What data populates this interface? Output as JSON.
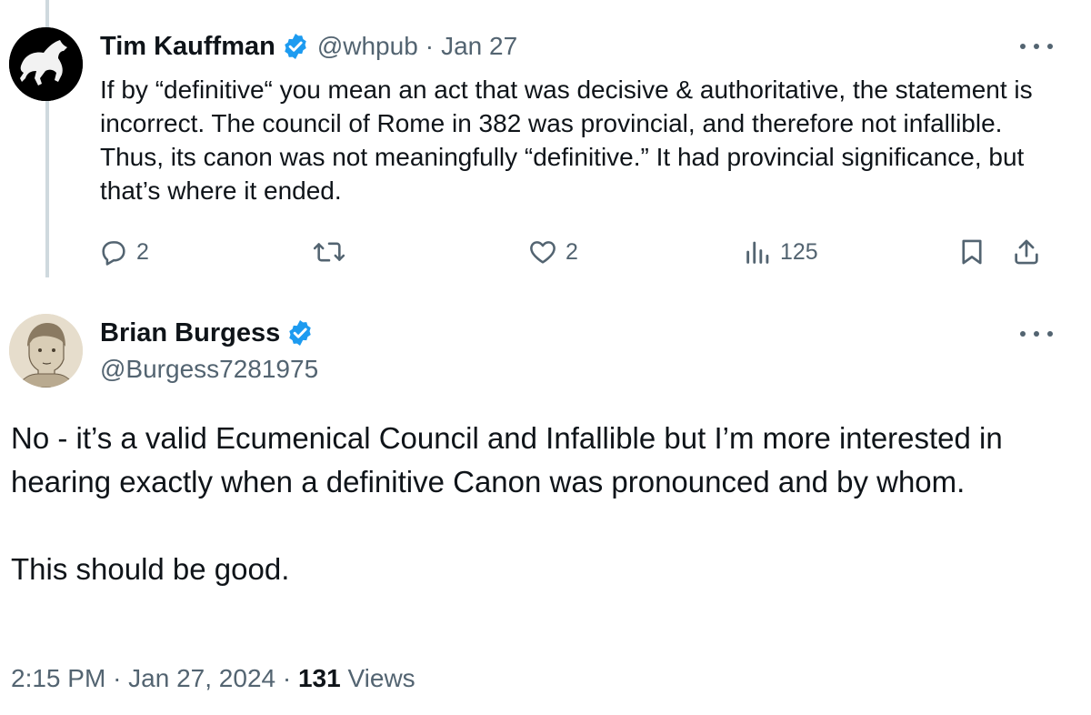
{
  "tweet1": {
    "name": "Tim Kauffman",
    "handle": "@whpub",
    "separator": "·",
    "date": "Jan 27",
    "text": "If by “definitive“ you mean an act that was decisive & authoritative, the statement is incorrect. The council of Rome in 382 was provincial, and therefore not infallible. Thus, its canon was not meaningfully “definitive.” It had provincial significance, but that’s where it ended.",
    "replies": "2",
    "likes": "2",
    "views": "125",
    "icons": [
      "reply-icon",
      "retweet-icon",
      "like-icon",
      "views-icon",
      "bookmark-icon",
      "share-icon",
      "more-icon",
      "verified-badge-icon"
    ]
  },
  "tweet2": {
    "name": "Brian Burgess",
    "handle": "@Burgess7281975",
    "paragraphs": [
      "No - it’s a valid Ecumenical Council and Infallible but I’m more interested in hearing exactly when a definitive Canon was pronounced and by whom.",
      "This should be good."
    ],
    "time": "2:15 PM",
    "sep1": "·",
    "full_date": "Jan 27, 2024",
    "sep2": "·",
    "views_count": "131",
    "views_label": "Views"
  },
  "colors": {
    "text": "#0f1419",
    "secondary": "#536471",
    "verified": "#1d9bf0",
    "thread_line": "#cfd9de"
  }
}
